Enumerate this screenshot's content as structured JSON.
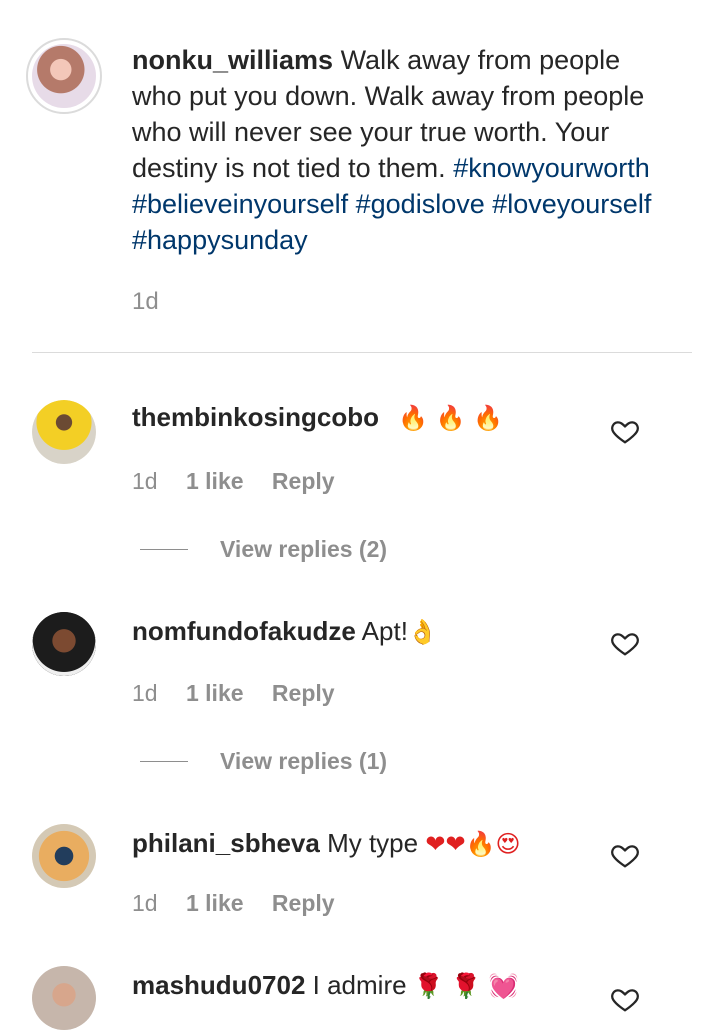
{
  "post": {
    "username": "nonku_williams",
    "caption": "Walk away from people who put you down. Walk away from people who will never see your true worth. Your destiny is not tied to them.",
    "hashtags": "#knowyourworth #believeinyourself #godislove #loveyourself #happysunday",
    "time": "1d"
  },
  "comments": [
    {
      "username": "thembinkosingcobo",
      "text": "",
      "emojis": "🔥 🔥 🔥",
      "time": "1d",
      "likes": "1 like",
      "reply": "Reply",
      "view_replies": "View replies (2)"
    },
    {
      "username": "nomfundofakudze",
      "text": "Apt!",
      "emojis": "👌",
      "time": "1d",
      "likes": "1 like",
      "reply": "Reply",
      "view_replies": "View replies (1)"
    },
    {
      "username": "philani_sbheva",
      "text": "My type",
      "emojis": "❤❤🔥😍",
      "time": "1d",
      "likes": "1 like",
      "reply": "Reply"
    },
    {
      "username": "mashudu0702",
      "text": "I admire",
      "emojis": "🌹 🌹 💓"
    }
  ],
  "colors": {
    "text": "#262626",
    "secondary": "#8e8e8e",
    "hashtag": "#00376b",
    "divider": "#dbdbdb"
  },
  "icons": {
    "like": "heart-outline-icon"
  }
}
